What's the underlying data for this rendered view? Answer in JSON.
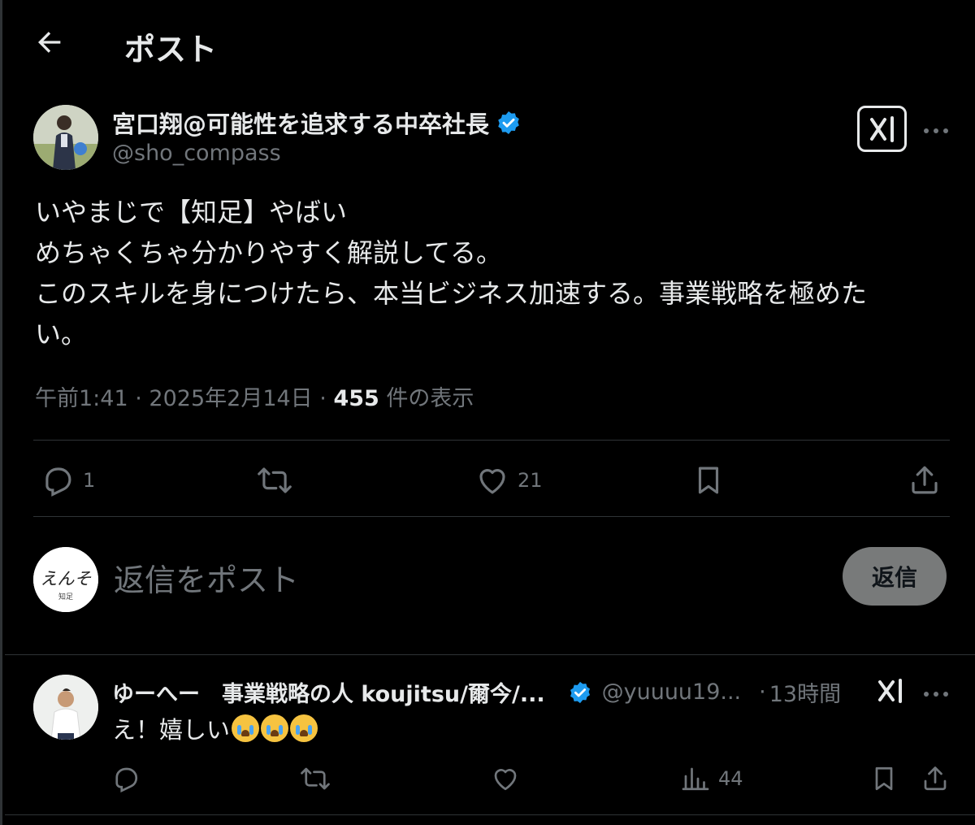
{
  "header": {
    "title": "ポスト"
  },
  "post": {
    "author_name": "宮口翔@可能性を追求する中卒社長",
    "handle": "@sho_compass",
    "lines": [
      "いやまじで【知足】やばい",
      "めちゃくちゃ分かりやすく解説してる。",
      "このスキルを身につけたら、本当ビジネス加速する。事業戦略を極めた",
      "い。"
    ],
    "time": "午前1:41",
    "date": "2025年2月14日",
    "views": "455",
    "views_label": "件の表示",
    "separator": "·",
    "reply_count": "1",
    "like_count": "21"
  },
  "composer": {
    "placeholder": "返信をポスト",
    "submit_label": "返信",
    "avatar_script": "えんそ",
    "avatar_caption": "知足"
  },
  "reply": {
    "author_name": "ゆーへー　事業戦略の人 koujitsu/爾今/...",
    "handle": "@yuuuu19...",
    "separator": "·",
    "time": "13時間",
    "text": "え！嬉しい",
    "emoji": [
      "loudly-crying-face",
      "loudly-crying-face",
      "loudly-crying-face"
    ],
    "view_count": "44"
  },
  "colors": {
    "background": "#000000",
    "text": "#e7e9ea",
    "muted": "#71767b",
    "divider": "#2f3336",
    "verified": "#1d9bf0",
    "reply_button": "#787a7a"
  }
}
